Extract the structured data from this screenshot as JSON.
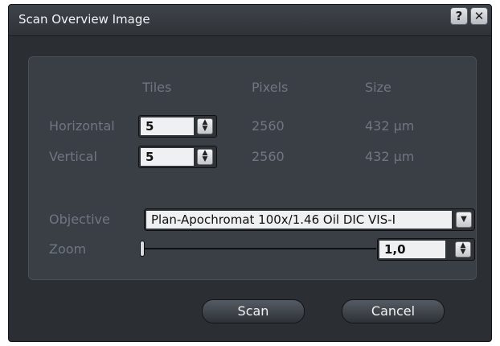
{
  "window": {
    "title": "Scan Overview Image",
    "help_label": "?",
    "close_label": "✕"
  },
  "columns": {
    "tiles": "Tiles",
    "pixels": "Pixels",
    "size": "Size"
  },
  "rows": [
    {
      "label": "Horizontal",
      "tiles": "5",
      "pixels": "2560",
      "size": "432 µm"
    },
    {
      "label": "Vertical",
      "tiles": "5",
      "pixels": "2560",
      "size": "432 µm"
    }
  ],
  "objective": {
    "label": "Objective",
    "value": "Plan-Apochromat 100x/1.46 Oil DIC VIS-I"
  },
  "zoom": {
    "label": "Zoom",
    "value": "1,0",
    "slider_level": 0.0
  },
  "buttons": {
    "scan": "Scan",
    "cancel": "Cancel"
  },
  "icons": {
    "spin": "spin-updown-icon",
    "dropdown": "chevron-down-icon"
  },
  "colors": {
    "panel": "#3a3e45",
    "dialog": "#2b2e33",
    "label": "#6f7782"
  }
}
